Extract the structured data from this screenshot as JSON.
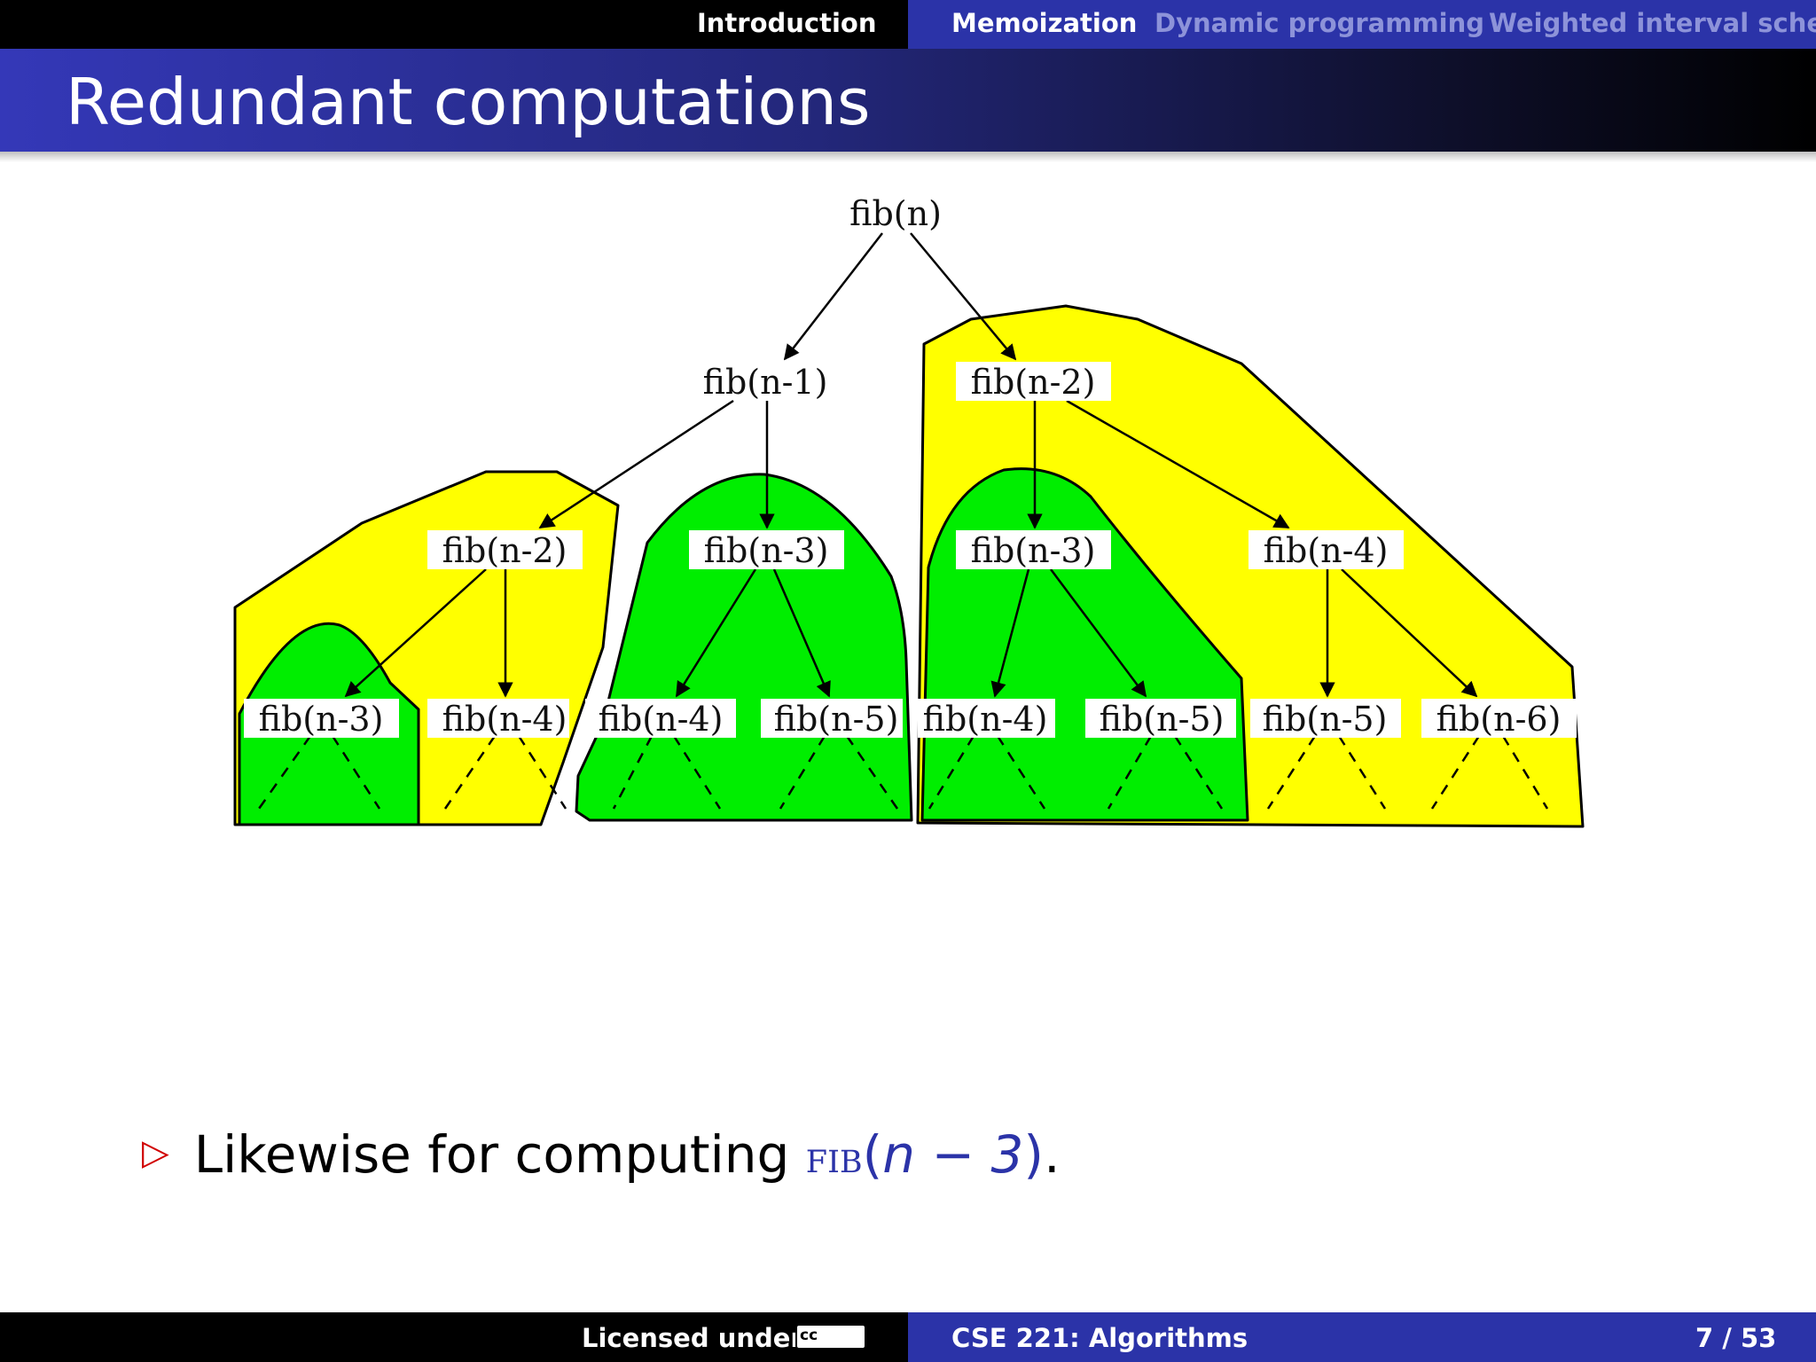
{
  "nav": {
    "sections": [
      "Introduction",
      "Memoization",
      "Dynamic programming",
      "Weighted interval sched"
    ]
  },
  "slide": {
    "title": "Redundant computations"
  },
  "diagram": {
    "nodes": {
      "root": "fib(n)",
      "l1a": "fib(n-1)",
      "l1b": "fib(n-2)",
      "l2a": "fib(n-2)",
      "l2b": "fib(n-3)",
      "l2c": "fib(n-3)",
      "l2d": "fib(n-4)",
      "l3a": "fib(n-3)",
      "l3b": "fib(n-4)",
      "l3c": "fib(n-4)",
      "l3d": "fib(n-5)",
      "l3e": "fib(n-4)",
      "l3f": "fib(n-5)",
      "l3g": "fib(n-5)",
      "l3h": "fib(n-6)"
    },
    "colors": {
      "yellow": "#ffff00",
      "green": "#00ee00"
    }
  },
  "bullet": {
    "text": "Likewise for computing",
    "fib": "fib",
    "open": "(",
    "arg": "n − 3",
    "close": ")",
    "period": "."
  },
  "footer": {
    "license": "Licensed under",
    "cc_badge": "cc",
    "course": "CSE 221: Algorithms",
    "page": "7 / 53"
  }
}
